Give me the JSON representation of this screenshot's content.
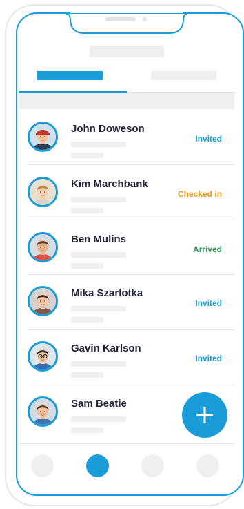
{
  "colors": {
    "accent": "#1a9cd8",
    "invited": "#1a9cd8",
    "checked_in": "#ef9a14",
    "arrived": "#2f9a57",
    "placeholder": "#efefef"
  },
  "guests": [
    {
      "name": "John Doweson",
      "status": "Invited",
      "status_color": "#1a9cd8"
    },
    {
      "name": "Kim Marchbank",
      "status": "Checked in",
      "status_color": "#ef9a14"
    },
    {
      "name": "Ben Mulins",
      "status": "Arrived",
      "status_color": "#2f9a57"
    },
    {
      "name": "Mika Szarlotka",
      "status": "Invited",
      "status_color": "#1a9cd8"
    },
    {
      "name": "Gavin Karlson",
      "status": "Invited",
      "status_color": "#1a9cd8"
    },
    {
      "name": "Sam Beatie",
      "status": "",
      "status_color": "#1a9cd8"
    }
  ],
  "fab": {
    "icon": "plus-icon"
  },
  "bottom_nav": {
    "items": 4,
    "active_index": 1
  }
}
